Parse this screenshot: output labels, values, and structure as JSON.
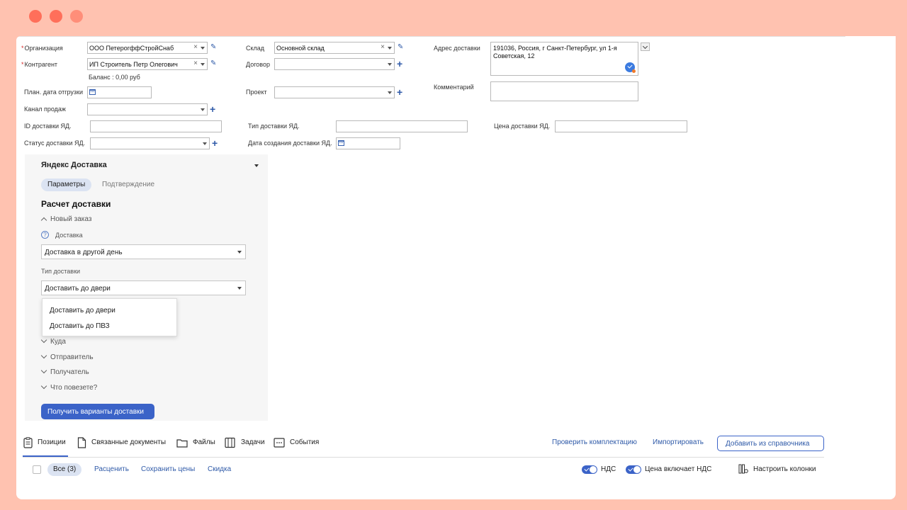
{
  "form": {
    "organization": {
      "label": "Организация",
      "value": "ООО ПетерогффСтройСнаб"
    },
    "counterparty": {
      "label": "Контрагент",
      "value": "ИП Строитель Петр Олегович"
    },
    "balance": "Баланс : 0,00 руб",
    "ship_date": {
      "label": "План. дата отгрузки"
    },
    "sales_channel": {
      "label": "Канал продаж"
    },
    "yd_id": {
      "label": "ID доставки ЯД."
    },
    "yd_status": {
      "label": "Статус доставки ЯД."
    },
    "warehouse": {
      "label": "Склад",
      "value": "Основной склад"
    },
    "contract": {
      "label": "Договор"
    },
    "project": {
      "label": "Проект"
    },
    "yd_type": {
      "label": "Тип доставки ЯД."
    },
    "yd_created": {
      "label": "Дата создания доставки ЯД."
    },
    "address": {
      "label": "Адрес доставки",
      "value": "191036, Россия, г Санкт-Петербург, ул 1-я Советская, 12"
    },
    "comment": {
      "label": "Комментарий"
    },
    "yd_price": {
      "label": "Цена доставки ЯД."
    }
  },
  "yandex": {
    "title": "Яндекс Доставка",
    "tabs": [
      "Параметры",
      "Подтверждение"
    ],
    "calc_title": "Расчет доставки",
    "new_order": "Новый заказ",
    "delivery_label": "Доставка",
    "delivery_value": "Доставка в другой день",
    "type_label": "Тип доставки",
    "type_value": "Доставить до двери",
    "type_options": [
      "Доставить до двери",
      "Доставить до ПВЗ"
    ],
    "sections": [
      "Куда",
      "Отправитель",
      "Получатель",
      "Что повезете?"
    ],
    "get_options_button": "Получить варианты доставки"
  },
  "bottom_tabs": [
    "Позиции",
    "Связанные документы",
    "Файлы",
    "Задачи",
    "События"
  ],
  "actions": {
    "check": "Проверить комплектацию",
    "import": "Импортировать",
    "add_from_catalog": "Добавить из справочника"
  },
  "toolbar": {
    "all": "Все (3)",
    "price": "Расценить",
    "save_prices": "Сохранить цены",
    "discount": "Скидка",
    "vat": "НДС",
    "price_incl_vat": "Цена включает НДС",
    "columns": "Настроить колонки"
  },
  "colors": {
    "accent": "#3b63c8",
    "frame": "#ffc2b0",
    "required": "#d62c2c"
  }
}
